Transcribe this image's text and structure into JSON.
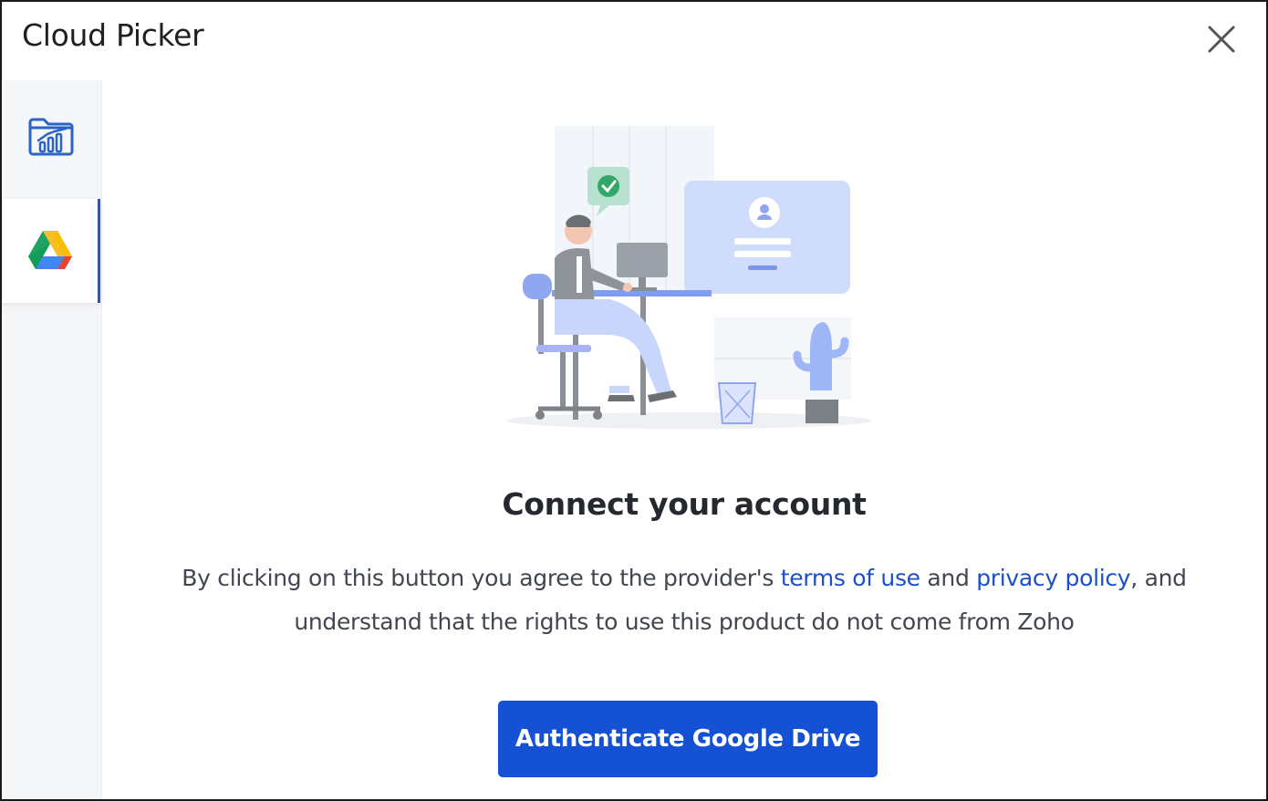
{
  "dialog": {
    "title": "Cloud Picker",
    "close_icon": "close-icon"
  },
  "sidebar": {
    "items": [
      {
        "icon": "folder-chart-icon",
        "selected": false
      },
      {
        "icon": "google-drive-icon",
        "selected": true
      }
    ]
  },
  "main": {
    "illustration": "person-at-desk-login-illustration",
    "heading": "Connect your account",
    "desc_part1": "By clicking on this button you agree to the provider's ",
    "terms_link": "terms of use",
    "desc_part2": " and ",
    "privacy_link": "privacy policy",
    "desc_part3": ", and",
    "desc_line2": "understand that the rights to use this product do not come from Zoho",
    "button_label": "Authenticate Google Drive"
  },
  "colors": {
    "accent": "#1451d4",
    "link": "#1b50c9",
    "sidebar_bg": "#f5f6f8"
  }
}
